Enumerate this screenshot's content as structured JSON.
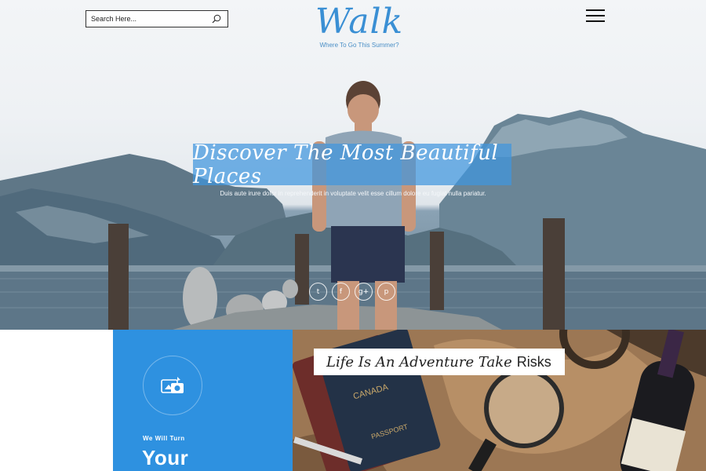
{
  "header": {
    "search_placeholder": "Search Here...",
    "logo": "Walk",
    "tagline": "Where To Go This Summer?"
  },
  "hero": {
    "headline": "Discover The Most Beautiful Places",
    "subtext": "Duis aute irure dolor in reprehenderit in voluptate velit esse cillum dolore eu fugiat nulla pariatur.",
    "social": [
      {
        "icon": "twitter-icon",
        "glyph": "t"
      },
      {
        "icon": "facebook-icon",
        "glyph": "f"
      },
      {
        "icon": "google-plus-icon",
        "glyph": "g+"
      },
      {
        "icon": "pinterest-icon",
        "glyph": "p"
      }
    ]
  },
  "feature": {
    "kicker": "We Will Turn",
    "title": "Your"
  },
  "banner": {
    "title_script": "Life Is An Adventure Take",
    "title_plain": "Risks"
  },
  "colors": {
    "accent": "#2e91e0",
    "logo": "#3a8fd4"
  }
}
